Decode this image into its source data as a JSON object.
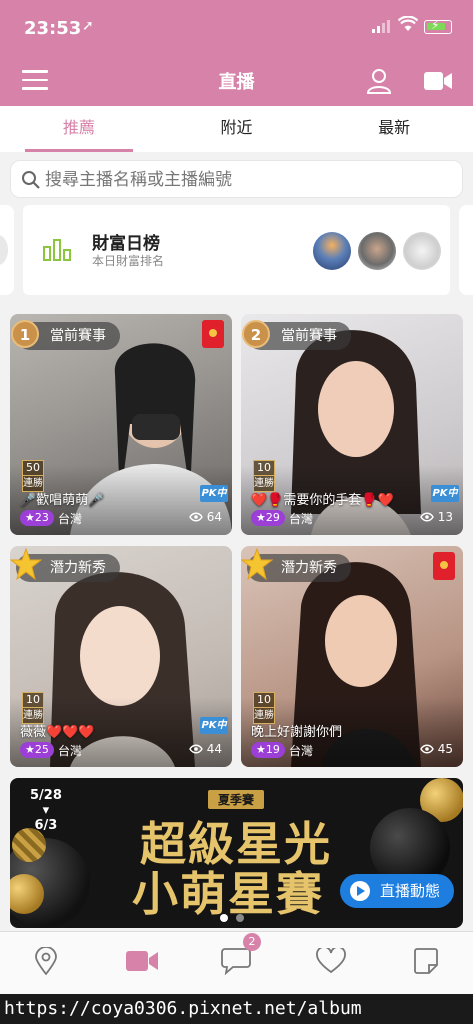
{
  "status_bar": {
    "time": "23:53"
  },
  "header": {
    "title": "直播"
  },
  "tabs": [
    {
      "label": "推薦",
      "active": true
    },
    {
      "label": "附近",
      "active": false
    },
    {
      "label": "最新",
      "active": false
    }
  ],
  "search": {
    "placeholder": "搜尋主播名稱或主播編號",
    "value": ""
  },
  "ranking": {
    "title": "財富日榜",
    "subtitle": "本日財富排名"
  },
  "cards": [
    {
      "event": "當前賽事",
      "wins_number": "50",
      "wins_label": "連勝",
      "caption": "🎤歡唱萌萌🎤",
      "level": "★23",
      "region": "台灣",
      "viewers": "64",
      "pk": "PK中"
    },
    {
      "event": "當前賽事",
      "wins_number": "10",
      "wins_label": "連勝",
      "caption": "❤️🥊需要你的手套🥊❤️",
      "level": "★29",
      "region": "台灣",
      "viewers": "13",
      "pk": "PK中"
    },
    {
      "event": "潛力新秀",
      "wins_number": "10",
      "wins_label": "連勝",
      "caption": "薇薇❤️❤️❤️",
      "level": "★25",
      "region": "台灣",
      "viewers": "44",
      "pk": "PK中"
    },
    {
      "event": "潛力新秀",
      "wins_number": "10",
      "wins_label": "連勝",
      "caption": "晚上好謝謝你們",
      "level": "★19",
      "region": "台灣",
      "viewers": "45"
    }
  ],
  "promo": {
    "date_start": "5/28",
    "date_end": "6/3",
    "season": "夏季賽",
    "title_line1": "超級星光",
    "title_line2": "小萌星賽",
    "live_button": "直播動態"
  },
  "bottom_nav": {
    "message_badge": "2"
  },
  "url_bar": "https://coya0306.pixnet.net/album",
  "colors": {
    "accent": "#d783a9",
    "live_button": "#1e7ee0",
    "level_badge": "#9b3fd6"
  }
}
